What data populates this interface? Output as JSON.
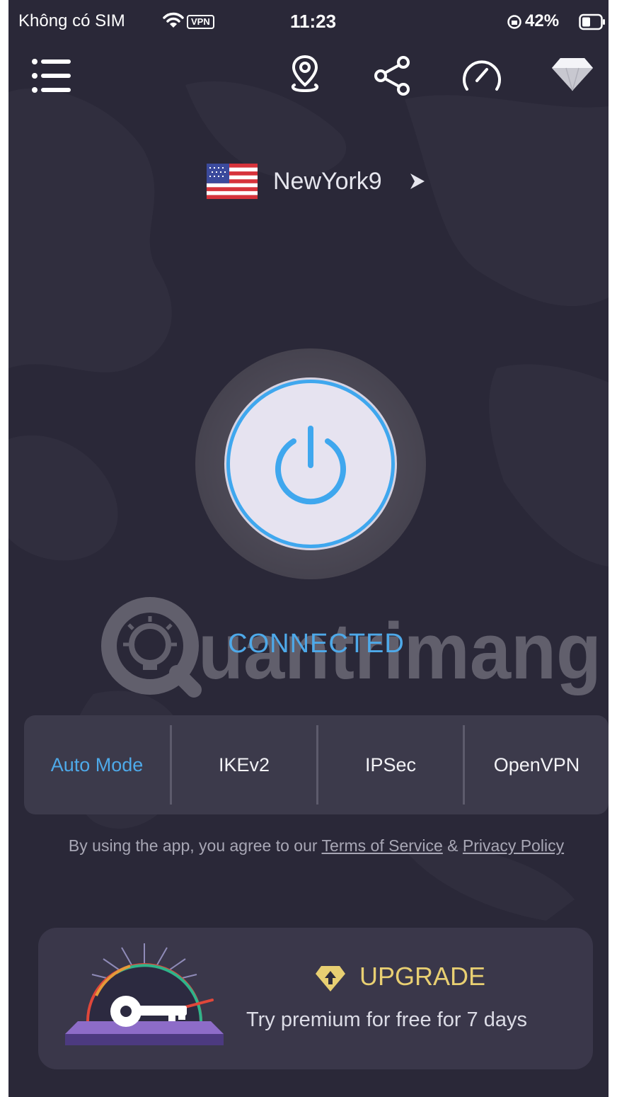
{
  "status_bar": {
    "carrier": "Không có SIM",
    "vpn_badge": "VPN",
    "time": "11:23",
    "battery": "42%"
  },
  "topbar": {
    "icons": [
      "menu-icon",
      "location-pin-icon",
      "share-icon",
      "speedometer-icon",
      "diamond-icon"
    ]
  },
  "location": {
    "name": "NewYork9",
    "flag": "us-flag-icon"
  },
  "connection": {
    "status": "CONNECTED"
  },
  "watermark": {
    "text": "uantrimang"
  },
  "protocols": {
    "selected": "Auto Mode",
    "items": [
      {
        "label": "Auto Mode"
      },
      {
        "label": "IKEv2"
      },
      {
        "label": "IPSec"
      },
      {
        "label": "OpenVPN"
      }
    ]
  },
  "terms": {
    "prefix": "By using the app, you agree to our ",
    "tos": "Terms of Service",
    "amp": " & ",
    "privacy": "Privacy Policy"
  },
  "upgrade": {
    "title": "UPGRADE",
    "subtitle": "Try premium for free for 7 days"
  },
  "colors": {
    "background": "#2a2838",
    "accent": "#4ea9e9",
    "upgrade_gold": "#e8cf72",
    "panel": "#3c3a4b"
  }
}
